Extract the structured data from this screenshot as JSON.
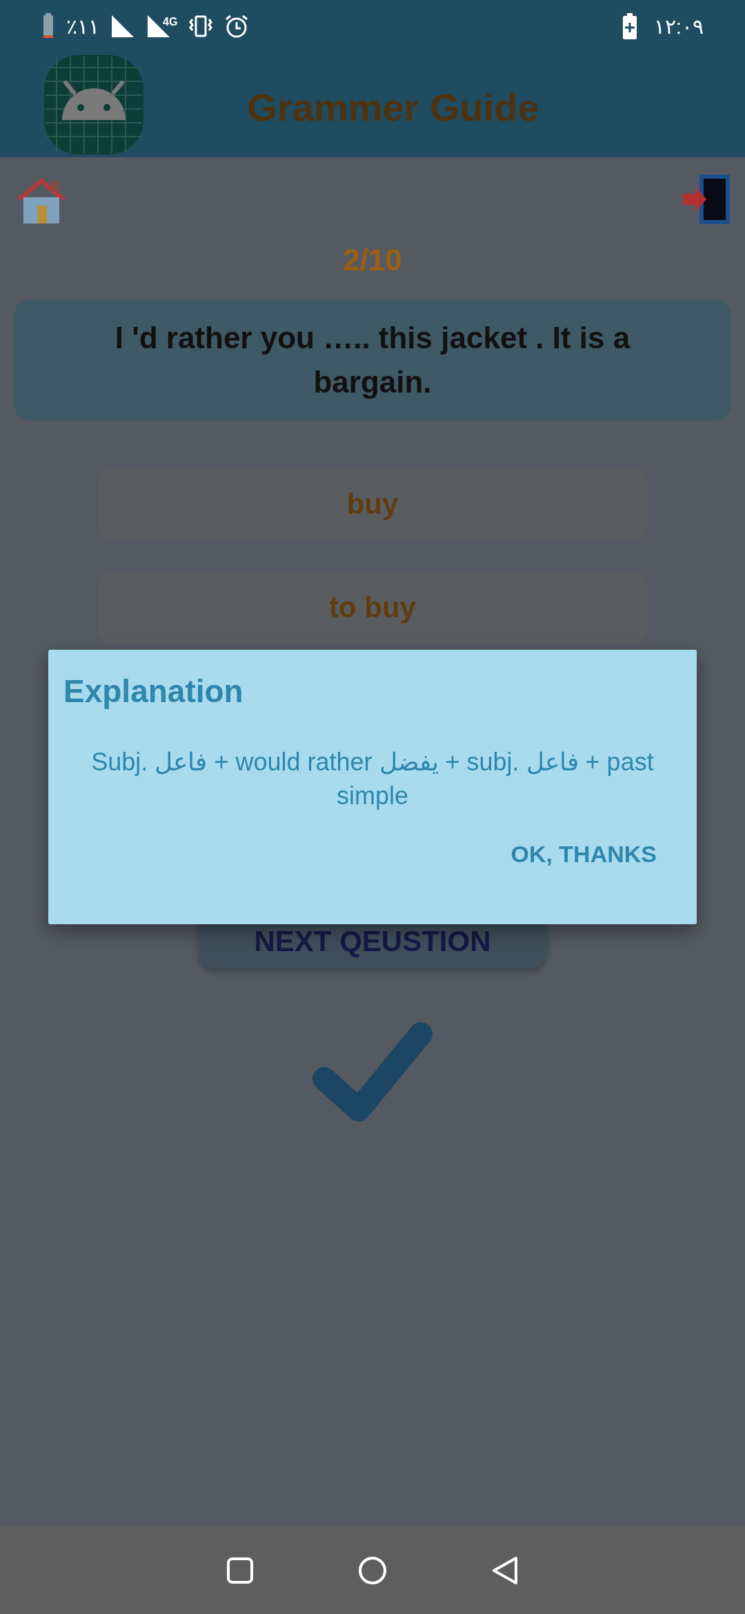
{
  "status_bar": {
    "battery_percent": "٪١١",
    "time": "١٢:٠٩",
    "network": "4G"
  },
  "app_bar": {
    "title": "Grammer Guide"
  },
  "quiz": {
    "progress": "2/10",
    "question": "I 'd rather you ….. this jacket . It is a bargain.",
    "options": [
      {
        "label": "buy"
      },
      {
        "label": "to buy"
      }
    ],
    "next_button": "NEXT QEUSTION"
  },
  "dialog": {
    "title": "Explanation",
    "message": "Subj. فاعل  + would rather يفضل  + subj. فاعل   + past simple",
    "button": "OK, THANKS"
  }
}
